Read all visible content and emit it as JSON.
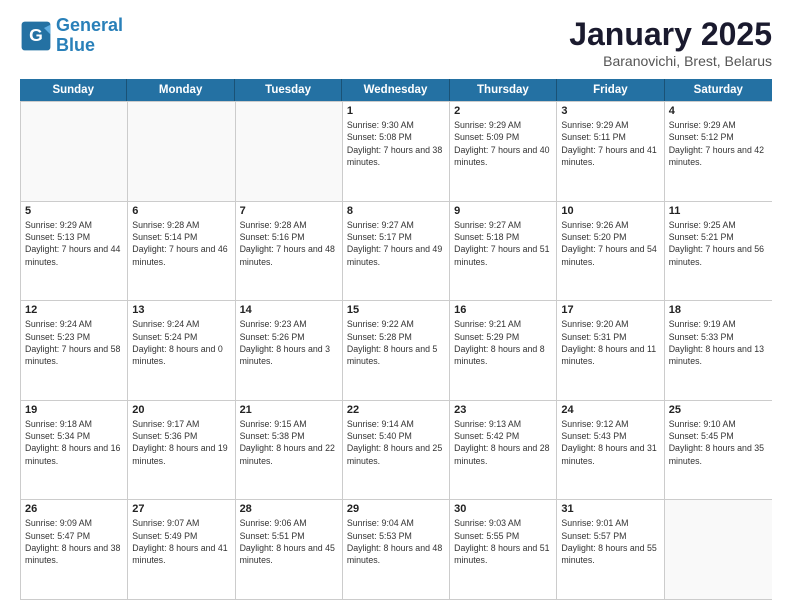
{
  "header": {
    "logo_line1": "General",
    "logo_line2": "Blue",
    "title": "January 2025",
    "subtitle": "Baranovichi, Brest, Belarus"
  },
  "weekdays": [
    "Sunday",
    "Monday",
    "Tuesday",
    "Wednesday",
    "Thursday",
    "Friday",
    "Saturday"
  ],
  "weeks": [
    [
      {
        "day": "",
        "sunrise": "",
        "sunset": "",
        "daylight": "",
        "empty": true
      },
      {
        "day": "",
        "sunrise": "",
        "sunset": "",
        "daylight": "",
        "empty": true
      },
      {
        "day": "",
        "sunrise": "",
        "sunset": "",
        "daylight": "",
        "empty": true
      },
      {
        "day": "1",
        "sunrise": "Sunrise: 9:30 AM",
        "sunset": "Sunset: 5:08 PM",
        "daylight": "Daylight: 7 hours and 38 minutes.",
        "empty": false
      },
      {
        "day": "2",
        "sunrise": "Sunrise: 9:29 AM",
        "sunset": "Sunset: 5:09 PM",
        "daylight": "Daylight: 7 hours and 40 minutes.",
        "empty": false
      },
      {
        "day": "3",
        "sunrise": "Sunrise: 9:29 AM",
        "sunset": "Sunset: 5:11 PM",
        "daylight": "Daylight: 7 hours and 41 minutes.",
        "empty": false
      },
      {
        "day": "4",
        "sunrise": "Sunrise: 9:29 AM",
        "sunset": "Sunset: 5:12 PM",
        "daylight": "Daylight: 7 hours and 42 minutes.",
        "empty": false
      }
    ],
    [
      {
        "day": "5",
        "sunrise": "Sunrise: 9:29 AM",
        "sunset": "Sunset: 5:13 PM",
        "daylight": "Daylight: 7 hours and 44 minutes.",
        "empty": false
      },
      {
        "day": "6",
        "sunrise": "Sunrise: 9:28 AM",
        "sunset": "Sunset: 5:14 PM",
        "daylight": "Daylight: 7 hours and 46 minutes.",
        "empty": false
      },
      {
        "day": "7",
        "sunrise": "Sunrise: 9:28 AM",
        "sunset": "Sunset: 5:16 PM",
        "daylight": "Daylight: 7 hours and 48 minutes.",
        "empty": false
      },
      {
        "day": "8",
        "sunrise": "Sunrise: 9:27 AM",
        "sunset": "Sunset: 5:17 PM",
        "daylight": "Daylight: 7 hours and 49 minutes.",
        "empty": false
      },
      {
        "day": "9",
        "sunrise": "Sunrise: 9:27 AM",
        "sunset": "Sunset: 5:18 PM",
        "daylight": "Daylight: 7 hours and 51 minutes.",
        "empty": false
      },
      {
        "day": "10",
        "sunrise": "Sunrise: 9:26 AM",
        "sunset": "Sunset: 5:20 PM",
        "daylight": "Daylight: 7 hours and 54 minutes.",
        "empty": false
      },
      {
        "day": "11",
        "sunrise": "Sunrise: 9:25 AM",
        "sunset": "Sunset: 5:21 PM",
        "daylight": "Daylight: 7 hours and 56 minutes.",
        "empty": false
      }
    ],
    [
      {
        "day": "12",
        "sunrise": "Sunrise: 9:24 AM",
        "sunset": "Sunset: 5:23 PM",
        "daylight": "Daylight: 7 hours and 58 minutes.",
        "empty": false
      },
      {
        "day": "13",
        "sunrise": "Sunrise: 9:24 AM",
        "sunset": "Sunset: 5:24 PM",
        "daylight": "Daylight: 8 hours and 0 minutes.",
        "empty": false
      },
      {
        "day": "14",
        "sunrise": "Sunrise: 9:23 AM",
        "sunset": "Sunset: 5:26 PM",
        "daylight": "Daylight: 8 hours and 3 minutes.",
        "empty": false
      },
      {
        "day": "15",
        "sunrise": "Sunrise: 9:22 AM",
        "sunset": "Sunset: 5:28 PM",
        "daylight": "Daylight: 8 hours and 5 minutes.",
        "empty": false
      },
      {
        "day": "16",
        "sunrise": "Sunrise: 9:21 AM",
        "sunset": "Sunset: 5:29 PM",
        "daylight": "Daylight: 8 hours and 8 minutes.",
        "empty": false
      },
      {
        "day": "17",
        "sunrise": "Sunrise: 9:20 AM",
        "sunset": "Sunset: 5:31 PM",
        "daylight": "Daylight: 8 hours and 11 minutes.",
        "empty": false
      },
      {
        "day": "18",
        "sunrise": "Sunrise: 9:19 AM",
        "sunset": "Sunset: 5:33 PM",
        "daylight": "Daylight: 8 hours and 13 minutes.",
        "empty": false
      }
    ],
    [
      {
        "day": "19",
        "sunrise": "Sunrise: 9:18 AM",
        "sunset": "Sunset: 5:34 PM",
        "daylight": "Daylight: 8 hours and 16 minutes.",
        "empty": false
      },
      {
        "day": "20",
        "sunrise": "Sunrise: 9:17 AM",
        "sunset": "Sunset: 5:36 PM",
        "daylight": "Daylight: 8 hours and 19 minutes.",
        "empty": false
      },
      {
        "day": "21",
        "sunrise": "Sunrise: 9:15 AM",
        "sunset": "Sunset: 5:38 PM",
        "daylight": "Daylight: 8 hours and 22 minutes.",
        "empty": false
      },
      {
        "day": "22",
        "sunrise": "Sunrise: 9:14 AM",
        "sunset": "Sunset: 5:40 PM",
        "daylight": "Daylight: 8 hours and 25 minutes.",
        "empty": false
      },
      {
        "day": "23",
        "sunrise": "Sunrise: 9:13 AM",
        "sunset": "Sunset: 5:42 PM",
        "daylight": "Daylight: 8 hours and 28 minutes.",
        "empty": false
      },
      {
        "day": "24",
        "sunrise": "Sunrise: 9:12 AM",
        "sunset": "Sunset: 5:43 PM",
        "daylight": "Daylight: 8 hours and 31 minutes.",
        "empty": false
      },
      {
        "day": "25",
        "sunrise": "Sunrise: 9:10 AM",
        "sunset": "Sunset: 5:45 PM",
        "daylight": "Daylight: 8 hours and 35 minutes.",
        "empty": false
      }
    ],
    [
      {
        "day": "26",
        "sunrise": "Sunrise: 9:09 AM",
        "sunset": "Sunset: 5:47 PM",
        "daylight": "Daylight: 8 hours and 38 minutes.",
        "empty": false
      },
      {
        "day": "27",
        "sunrise": "Sunrise: 9:07 AM",
        "sunset": "Sunset: 5:49 PM",
        "daylight": "Daylight: 8 hours and 41 minutes.",
        "empty": false
      },
      {
        "day": "28",
        "sunrise": "Sunrise: 9:06 AM",
        "sunset": "Sunset: 5:51 PM",
        "daylight": "Daylight: 8 hours and 45 minutes.",
        "empty": false
      },
      {
        "day": "29",
        "sunrise": "Sunrise: 9:04 AM",
        "sunset": "Sunset: 5:53 PM",
        "daylight": "Daylight: 8 hours and 48 minutes.",
        "empty": false
      },
      {
        "day": "30",
        "sunrise": "Sunrise: 9:03 AM",
        "sunset": "Sunset: 5:55 PM",
        "daylight": "Daylight: 8 hours and 51 minutes.",
        "empty": false
      },
      {
        "day": "31",
        "sunrise": "Sunrise: 9:01 AM",
        "sunset": "Sunset: 5:57 PM",
        "daylight": "Daylight: 8 hours and 55 minutes.",
        "empty": false
      },
      {
        "day": "",
        "sunrise": "",
        "sunset": "",
        "daylight": "",
        "empty": true
      }
    ]
  ]
}
